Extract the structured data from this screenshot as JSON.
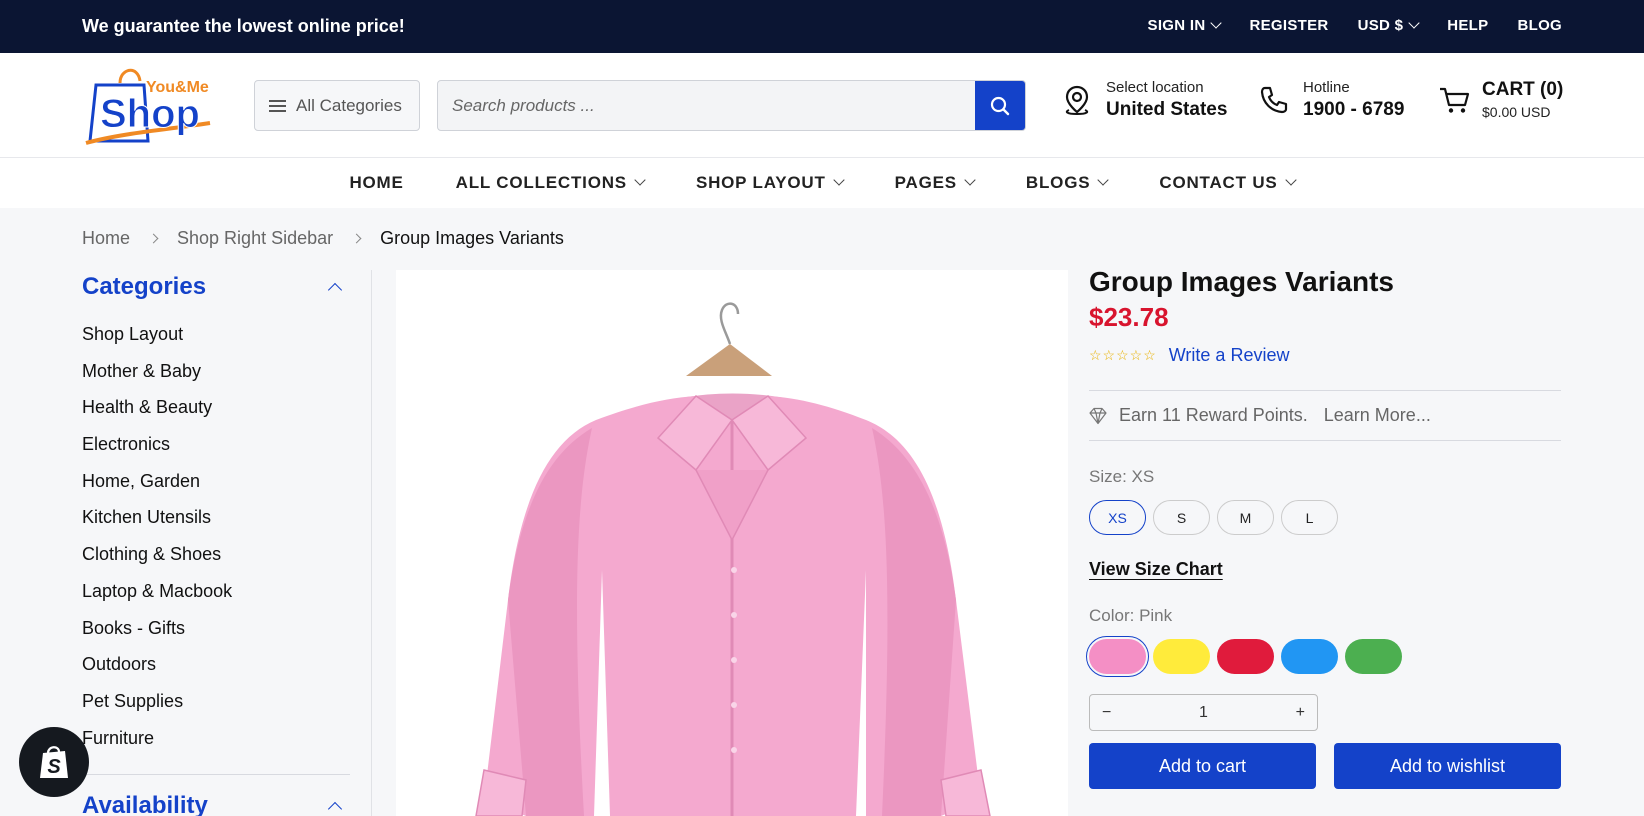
{
  "topbar": {
    "promo": "We guarantee the lowest online price!",
    "links": [
      "SIGN IN",
      "REGISTER",
      "USD $",
      "HELP",
      "BLOG"
    ]
  },
  "header": {
    "logo_top": "You&Me",
    "logo_main": "Shop",
    "all_categories": "All Categories",
    "search_placeholder": "Search products ...",
    "location_label": "Select location",
    "location_value": "United States",
    "hotline_label": "Hotline",
    "hotline_value": "1900 - 6789",
    "cart_label": "CART (0)",
    "cart_total": "$0.00 USD"
  },
  "nav": [
    "HOME",
    "ALL COLLECTIONS",
    "SHOP LAYOUT",
    "PAGES",
    "BLOGS",
    "CONTACT US"
  ],
  "breadcrumb": [
    "Home",
    "Shop Right Sidebar",
    "Group Images Variants"
  ],
  "sidebar": {
    "title": "Categories",
    "items": [
      "Shop Layout",
      "Mother & Baby",
      "Health & Beauty",
      "Electronics",
      "Home, Garden",
      "Kitchen Utensils",
      "Clothing & Shoes",
      "Laptop & Macbook",
      "Books - Gifts",
      "Outdoors",
      "Pet Supplies",
      "Furniture"
    ],
    "next_title": "Availability"
  },
  "product": {
    "title": "Group Images Variants",
    "price": "$23.78",
    "stars": "☆☆☆☆☆",
    "review_link": "Write a Review",
    "reward": "Earn 11 Reward Points.",
    "learn_more": "Learn More...",
    "size_label": "Size: XS",
    "sizes": [
      "XS",
      "S",
      "M",
      "L"
    ],
    "size_chart": "View Size Chart",
    "color_label": "Color: Pink",
    "colors": [
      "#f48fc5",
      "#ffeb3b",
      "#e01b3c",
      "#2196f3",
      "#4caf50"
    ],
    "qty_minus": "−",
    "qty_value": "1",
    "qty_plus": "+",
    "add_to_cart": "Add to cart",
    "add_to_wishlist": "Add to wishlist"
  },
  "colors": {
    "accent": "#1442c9",
    "price": "#d8142e",
    "topbar": "#0b1533"
  }
}
